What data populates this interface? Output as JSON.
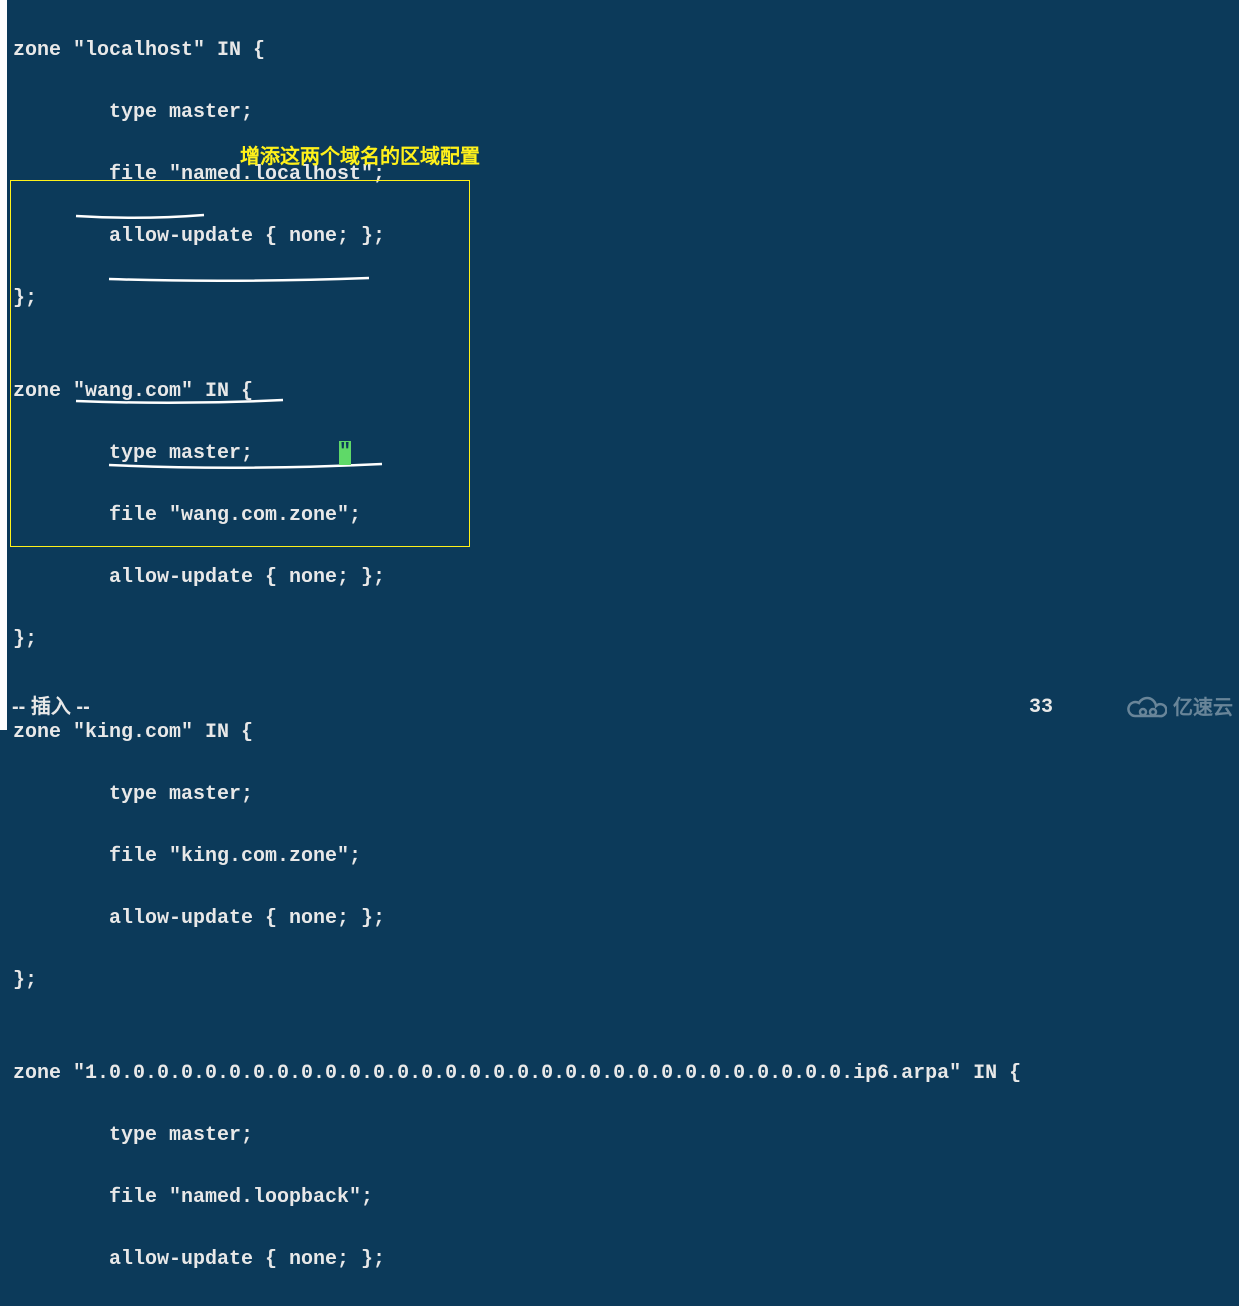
{
  "annotation": "增添这两个域名的区域配置",
  "status": "-- 插入 --",
  "pos": "33",
  "lines": {
    "l0": "zone \"localhost\" IN {",
    "l1": "        type master;",
    "l2": "        file \"named.localhost\";",
    "l3": "        allow-update { none; };",
    "l4": "};",
    "l5": "",
    "l6": "zone \"wang.com\" IN {",
    "l7": "        type master;",
    "l8": "        file \"wang.com.zone\";",
    "l9": "        allow-update { none; };",
    "l10": "};",
    "l11": "",
    "l12": "zone \"king.com\" IN {",
    "l13": "        type master;",
    "l14": "        file \"king.com.zone\";",
    "l15": "        allow-update { none; };",
    "l16": "};",
    "l17": "",
    "l18": "zone \"1.0.0.0.0.0.0.0.0.0.0.0.0.0.0.0.0.0.0.0.0.0.0.0.0.0.0.0.0.0.0.0.ip6.arpa\" IN {",
    "l19": "        type master;",
    "l20": "        file \"named.loopback\";",
    "l21": "        allow-update { none; };"
  },
  "watermark": "亿速云",
  "cursor_char": "\""
}
